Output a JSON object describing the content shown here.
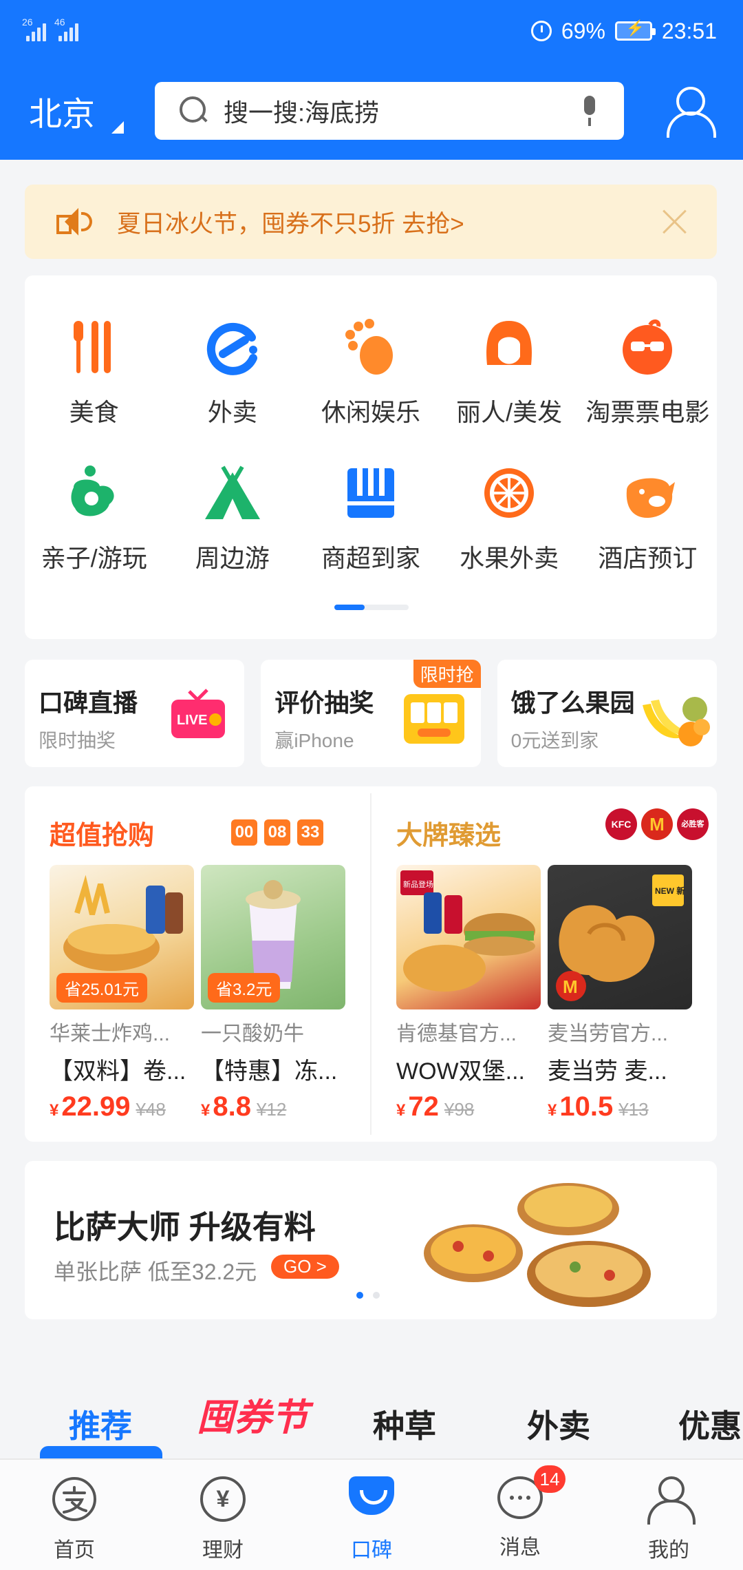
{
  "status_bar": {
    "signal1_label": "26",
    "signal2_label": "46",
    "battery": "69%",
    "time": "23:51"
  },
  "header": {
    "city": "北京",
    "search_placeholder": "搜一搜:海底捞"
  },
  "notice": {
    "text": "夏日冰火节，囤券不只5折 去抢>"
  },
  "categories": [
    {
      "label": "美食",
      "icon": "utensils-icon",
      "color": "#ff6a1a"
    },
    {
      "label": "外卖",
      "icon": "takeout-e-icon",
      "color": "#1677ff"
    },
    {
      "label": "休闲娱乐",
      "icon": "footprint-icon",
      "color": "#ff8a2b"
    },
    {
      "label": "丽人/美发",
      "icon": "woman-face-icon",
      "color": "#ff6a1a"
    },
    {
      "label": "淘票票电影",
      "icon": "glasses-mascot-icon",
      "color": "#ff5a1f"
    },
    {
      "label": "亲子/游玩",
      "icon": "baby-icon",
      "color": "#1db36b"
    },
    {
      "label": "周边游",
      "icon": "tent-icon",
      "color": "#1db36b"
    },
    {
      "label": "商超到家",
      "icon": "store-icon",
      "color": "#1677ff"
    },
    {
      "label": "水果外卖",
      "icon": "orange-slice-icon",
      "color": "#ff6a1a"
    },
    {
      "label": "酒店预订",
      "icon": "pig-icon",
      "color": "#ff8a2b"
    }
  ],
  "promos": [
    {
      "title": "口碑直播",
      "subtitle": "限时抽奖",
      "image_text": "LIVE"
    },
    {
      "title": "评价抽奖",
      "subtitle": "赢iPhone",
      "badge": "限时抢"
    },
    {
      "title": "饿了么果园",
      "subtitle": "0元送到家"
    }
  ],
  "flash_sale": {
    "title": "超值抢购",
    "countdown": [
      "00",
      "08",
      "33"
    ],
    "products": [
      {
        "save": "省25.01元",
        "shop": "华莱士炸鸡...",
        "name": "【双料】卷...",
        "currency": "¥",
        "price": "22.99",
        "original": "¥48"
      },
      {
        "save": "省3.2元",
        "shop": "一只酸奶牛",
        "name": "【特惠】冻...",
        "currency": "¥",
        "price": "8.8",
        "original": "¥12"
      }
    ]
  },
  "brand_select": {
    "title": "大牌臻选",
    "logos": [
      "KFC",
      "M",
      "必胜客"
    ],
    "products": [
      {
        "shop": "肯德基官方...",
        "name": "WOW双堡...",
        "currency": "¥",
        "price": "72",
        "original": "¥98",
        "image_tag": "新品登场"
      },
      {
        "shop": "麦当劳官方...",
        "name": "麦当劳 麦...",
        "currency": "¥",
        "price": "10.5",
        "original": "¥13",
        "image_tag": "NEW 新"
      }
    ]
  },
  "banner": {
    "title": "比萨大师 升级有料",
    "subtitle": "单张比萨 低至32.2元",
    "go": "GO >"
  },
  "feed_tabs": [
    "推荐",
    "囤券节",
    "种草",
    "外卖",
    "优惠"
  ],
  "bottom_nav": [
    {
      "label": "首页",
      "icon": "alipay-home-icon"
    },
    {
      "label": "理财",
      "icon": "yuan-icon",
      "glyph": "¥"
    },
    {
      "label": "口碑",
      "icon": "koubei-icon",
      "active": true
    },
    {
      "label": "消息",
      "icon": "chat-bubble-icon",
      "badge": "14"
    },
    {
      "label": "我的",
      "icon": "person-icon"
    }
  ],
  "colors": {
    "primary": "#1677ff",
    "accent": "#ff6a1a",
    "price": "#ff3b1f",
    "notice_bg": "#fdf1d6"
  }
}
